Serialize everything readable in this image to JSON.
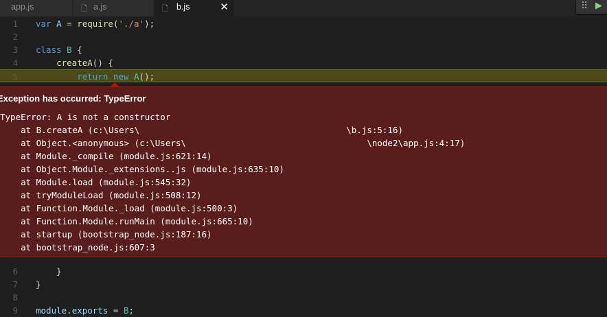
{
  "tabs": [
    {
      "label": "app.js",
      "active": false
    },
    {
      "label": "a.js",
      "active": false
    },
    {
      "label": "b.js",
      "active": true
    }
  ],
  "tab_close_glyph": "✕",
  "debug_toolbar": {
    "grip_glyph": "⠿",
    "continue_glyph": "▶"
  },
  "code_top": [
    {
      "num": "1",
      "tokens": [
        {
          "t": "var",
          "c": "kw"
        },
        {
          "t": " ",
          "c": ""
        },
        {
          "t": "A",
          "c": "var"
        },
        {
          "t": " = ",
          "c": ""
        },
        {
          "t": "require",
          "c": "fn"
        },
        {
          "t": "(",
          "c": ""
        },
        {
          "t": "'./a'",
          "c": "str"
        },
        {
          "t": ");",
          "c": ""
        }
      ]
    },
    {
      "num": "2",
      "tokens": []
    },
    {
      "num": "3",
      "tokens": [
        {
          "t": "class",
          "c": "kw"
        },
        {
          "t": " ",
          "c": ""
        },
        {
          "t": "B",
          "c": "cls"
        },
        {
          "t": " {",
          "c": ""
        }
      ]
    },
    {
      "num": "4",
      "tokens": [
        {
          "t": "    ",
          "c": ""
        },
        {
          "t": "createA",
          "c": "fn"
        },
        {
          "t": "() {",
          "c": ""
        }
      ]
    },
    {
      "num": "5",
      "tokens": [
        {
          "t": "        ",
          "c": ""
        },
        {
          "t": "return",
          "c": "kw"
        },
        {
          "t": " ",
          "c": ""
        },
        {
          "t": "new",
          "c": "kw"
        },
        {
          "t": " ",
          "c": ""
        },
        {
          "t": "A",
          "c": "cls"
        },
        {
          "t": "();",
          "c": ""
        }
      ],
      "highlight": true
    }
  ],
  "exception": {
    "title": "Exception has occurred: TypeError",
    "stack": [
      "TypeError: A is not a constructor",
      "    at B.createA (c:\\Users\\                                        \\b.js:5:16)",
      "    at Object.<anonymous> (c:\\Users\\                                   \\node2\\app.js:4:17)",
      "    at Module._compile (module.js:621:14)",
      "    at Object.Module._extensions..js (module.js:635:10)",
      "    at Module.load (module.js:545:32)",
      "    at tryModuleLoad (module.js:508:12)",
      "    at Function.Module._load (module.js:500:3)",
      "    at Function.Module.runMain (module.js:665:10)",
      "    at startup (bootstrap_node.js:187:16)",
      "    at bootstrap_node.js:607:3"
    ]
  },
  "code_bottom": [
    {
      "num": "6",
      "tokens": [
        {
          "t": "    }",
          "c": ""
        }
      ]
    },
    {
      "num": "7",
      "tokens": [
        {
          "t": "}",
          "c": ""
        }
      ]
    },
    {
      "num": "8",
      "tokens": []
    },
    {
      "num": "9",
      "tokens": [
        {
          "t": "module",
          "c": "var"
        },
        {
          "t": ".",
          "c": ""
        },
        {
          "t": "exports",
          "c": "var"
        },
        {
          "t": " = ",
          "c": ""
        },
        {
          "t": "B",
          "c": "cls"
        },
        {
          "t": ";",
          "c": ""
        }
      ]
    }
  ]
}
